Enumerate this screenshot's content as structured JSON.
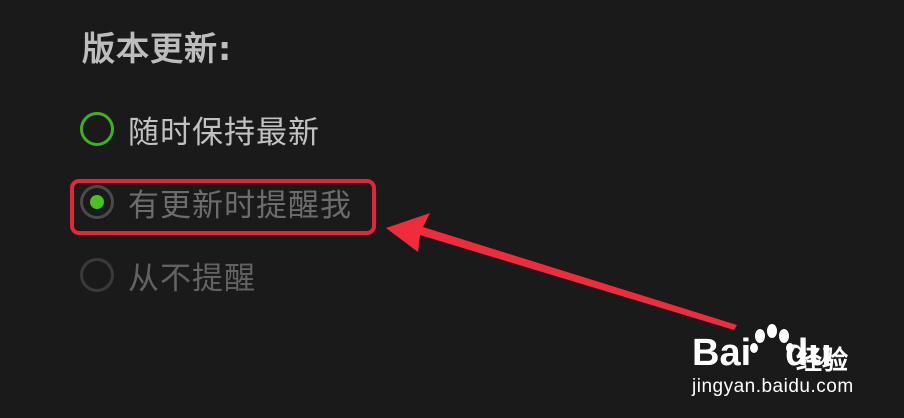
{
  "section": {
    "title": "版本更新:"
  },
  "options": [
    {
      "label": "随时保持最新",
      "selected": false
    },
    {
      "label": "有更新时提醒我",
      "selected": true
    },
    {
      "label": "从不提醒",
      "selected": false
    }
  ],
  "annotation": {
    "highlight_color": "#e8243a",
    "arrow_color": "#ef2b3c"
  },
  "colors": {
    "background": "#1a1a1a",
    "radio_green": "#3db318"
  },
  "watermark": {
    "brand_prefix": "Bai",
    "brand_suffix": "du",
    "product": "经验",
    "url": "jingyan.baidu.com"
  }
}
